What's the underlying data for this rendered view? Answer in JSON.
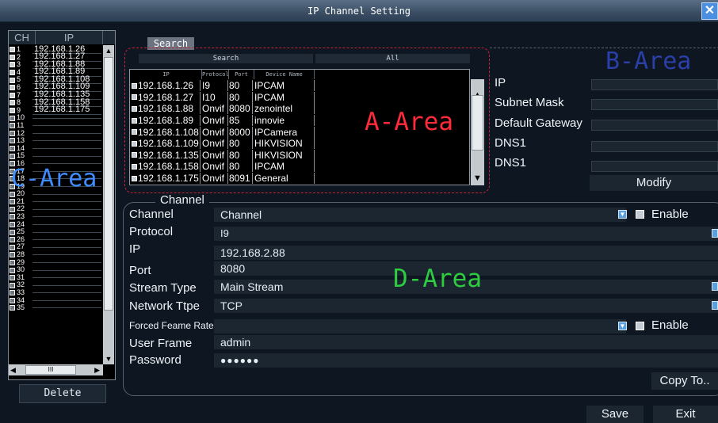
{
  "window": {
    "title": "IP Channel Setting",
    "close_glyph": "✕"
  },
  "channel_list": {
    "header": {
      "ch": "CH",
      "ip": "IP"
    },
    "rows": [
      {
        "num": "1",
        "ip": "192.168.1.26",
        "checked": true
      },
      {
        "num": "2",
        "ip": "192.168.1.27",
        "checked": true
      },
      {
        "num": "3",
        "ip": "192.168.1.88",
        "checked": true
      },
      {
        "num": "4",
        "ip": "192.168.1.89",
        "checked": true
      },
      {
        "num": "5",
        "ip": "192.168.1.108",
        "checked": true
      },
      {
        "num": "6",
        "ip": "192.168.1.109",
        "checked": true
      },
      {
        "num": "7",
        "ip": "192.168.1.135",
        "checked": true
      },
      {
        "num": "8",
        "ip": "192.168.1.158",
        "checked": true
      },
      {
        "num": "9",
        "ip": "192.168.1.175",
        "checked": true
      },
      {
        "num": "10",
        "ip": "",
        "checked": false
      },
      {
        "num": "11",
        "ip": "",
        "checked": false
      },
      {
        "num": "12",
        "ip": "",
        "checked": false
      },
      {
        "num": "13",
        "ip": "",
        "checked": false
      },
      {
        "num": "14",
        "ip": "",
        "checked": false
      },
      {
        "num": "15",
        "ip": "",
        "checked": false
      },
      {
        "num": "16",
        "ip": "",
        "checked": false
      },
      {
        "num": "17",
        "ip": "",
        "checked": false
      },
      {
        "num": "18",
        "ip": "",
        "checked": false
      },
      {
        "num": "19",
        "ip": "",
        "checked": false
      },
      {
        "num": "20",
        "ip": "",
        "checked": false
      },
      {
        "num": "21",
        "ip": "",
        "checked": false
      },
      {
        "num": "22",
        "ip": "",
        "checked": false
      },
      {
        "num": "23",
        "ip": "",
        "checked": false
      },
      {
        "num": "24",
        "ip": "",
        "checked": false
      },
      {
        "num": "25",
        "ip": "",
        "checked": false
      },
      {
        "num": "26",
        "ip": "",
        "checked": false
      },
      {
        "num": "27",
        "ip": "",
        "checked": false
      },
      {
        "num": "28",
        "ip": "",
        "checked": false
      },
      {
        "num": "29",
        "ip": "",
        "checked": false
      },
      {
        "num": "30",
        "ip": "",
        "checked": false
      },
      {
        "num": "31",
        "ip": "",
        "checked": false
      },
      {
        "num": "32",
        "ip": "",
        "checked": false
      },
      {
        "num": "33",
        "ip": "",
        "checked": false
      },
      {
        "num": "34",
        "ip": "",
        "checked": false
      },
      {
        "num": "35",
        "ip": "",
        "checked": false
      }
    ],
    "area_label": "C-Area",
    "hscroll_thumb_glyph": "III",
    "delete_label": "Delete"
  },
  "search": {
    "tab_label": "Search",
    "search_button": "Search",
    "all_button": "All",
    "columns": [
      "IP",
      "Protocol",
      "Port",
      "Device Name"
    ],
    "rows": [
      {
        "ip": "192.168.1.26",
        "protocol": "I9",
        "port": "80",
        "device": "IPCAM"
      },
      {
        "ip": "192.168.1.27",
        "protocol": "I10",
        "port": "80",
        "device": "IPCAM"
      },
      {
        "ip": "192.168.1.88",
        "protocol": "Onvif",
        "port": "8080",
        "device": "zenointel"
      },
      {
        "ip": "192.168.1.89",
        "protocol": "Onvif",
        "port": "85",
        "device": "innovie"
      },
      {
        "ip": "192.168.1.108",
        "protocol": "Onvif",
        "port": "8000",
        "device": "IPCamera"
      },
      {
        "ip": "192.168.1.109",
        "protocol": "Onvif",
        "port": "80",
        "device": "HIKVISION"
      },
      {
        "ip": "192.168.1.135",
        "protocol": "Onvif",
        "port": "80",
        "device": "HIKVISION"
      },
      {
        "ip": "192.168.1.158",
        "protocol": "Onvif",
        "port": "80",
        "device": "IPCAM"
      },
      {
        "ip": "192.168.1.175",
        "protocol": "Onvif",
        "port": "8091",
        "device": "General"
      }
    ],
    "area_label": "A-Area"
  },
  "network": {
    "area_label": "B-Area",
    "labels": {
      "ip": "IP",
      "subnet": "Subnet Mask",
      "gateway": "Default Gateway",
      "dns1": "DNS1",
      "dns2": "DNS1"
    },
    "modify_label": "Modify"
  },
  "channel_settings": {
    "group_title": "Channel",
    "area_label": "D-Area",
    "labels": {
      "channel": "Channel",
      "protocol": "Protocol",
      "ip": "IP",
      "port": "Port",
      "stream_type": "Stream Type",
      "network_type": "Network Ttpe",
      "forced_frame_rate": "Forced Feame Rate",
      "user": "User Frame",
      "password": "Password"
    },
    "values": {
      "channel": "Channel",
      "protocol": "I9",
      "ip": "192.168.2.88",
      "port": "8080",
      "stream_type": "Main Stream",
      "network_type": "TCP",
      "forced_frame_rate": "",
      "user": "admin",
      "password": "●●●●●●"
    },
    "enable_label": "Enable",
    "enable2_label": "Enable",
    "copy_to_label": "Copy To.."
  },
  "footer": {
    "save_label": "Save",
    "exit_label": "Exit"
  },
  "colors": {
    "a_area": "#ff2a3a",
    "b_area": "#2b3fa8",
    "c_area": "#3e8cff",
    "d_area": "#2ecc40",
    "close": "#4a8fe0"
  }
}
